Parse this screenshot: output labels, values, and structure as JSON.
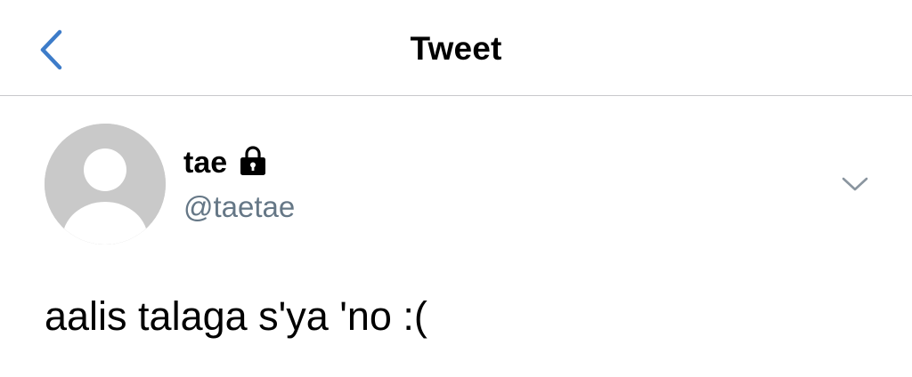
{
  "nav": {
    "title": "Tweet",
    "back_icon": "chevron-left-icon",
    "accent_color": "#3d7cc9"
  },
  "tweet": {
    "author": {
      "display_name": "tae",
      "handle": "@taetae",
      "protected_icon": "lock-icon",
      "avatar": "default-avatar"
    },
    "menu_icon": "chevron-down-icon",
    "text": "aalis talaga s'ya 'no :("
  }
}
